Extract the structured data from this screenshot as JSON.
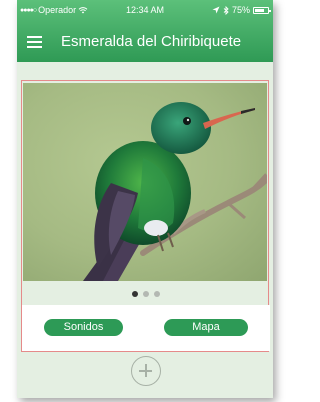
{
  "status_bar": {
    "carrier": "Operador",
    "signal_icon": "signal-dots-icon",
    "wifi_icon": "wifi-icon",
    "time": "12:34 AM",
    "location_icon": "location-arrow-icon",
    "bluetooth_icon": "bluetooth-icon",
    "battery_percent": "75%"
  },
  "header": {
    "title": "Esmeralda del Chiribiquete",
    "menu_icon": "hamburger-menu-icon",
    "accent_color": "#2f9a55"
  },
  "gallery": {
    "image_subject": "hummingbird",
    "page_count": 3,
    "active_page": 1
  },
  "actions": {
    "sounds_label": "Sonidos",
    "map_label": "Mapa",
    "button_color": "#2d9a56"
  },
  "add_button": {
    "icon": "plus-circle-icon"
  }
}
